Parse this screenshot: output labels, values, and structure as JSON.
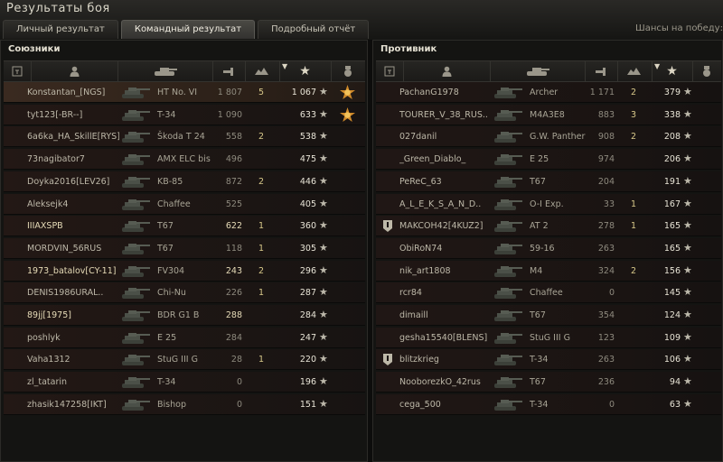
{
  "window": {
    "title": "Результаты боя"
  },
  "tabs": [
    {
      "label": "Личный результат",
      "active": false
    },
    {
      "label": "Командный результат",
      "active": true
    },
    {
      "label": "Подробный отчёт",
      "active": false
    }
  ],
  "win_chance_label": "Шансы на победу: (",
  "columns": {
    "squad_icon": "platoon-icon",
    "player_icon": "player-icon",
    "tank_icon": "tank-icon",
    "damage_icon": "damage-icon",
    "kills_icon": "kills-icon",
    "xp_icon": "star-icon",
    "medal_icon": "medal-icon",
    "sort_indicator": "▼"
  },
  "allies": {
    "title": "Союзники",
    "rows": [
      {
        "name": "Konstantan_[NGS]",
        "tank": "HT No. VI",
        "damage": "1 807",
        "kills": "5",
        "xp": "1 067",
        "achievement": true,
        "highlight": true
      },
      {
        "name": "tyt123[-BR--]",
        "tank": "T-34",
        "damage": "1 090",
        "kills": "",
        "xp": "633",
        "achievement": true
      },
      {
        "name": "6a6ka_HA_SkillE[RYS]",
        "tank": "Škoda T 24",
        "damage": "558",
        "kills": "2",
        "xp": "538"
      },
      {
        "name": "73nagibator7",
        "tank": "AMX ELC bis",
        "damage": "496",
        "kills": "",
        "xp": "475"
      },
      {
        "name": "Doyka2016[LEV26]",
        "tank": "KB-85",
        "damage": "872",
        "kills": "2",
        "xp": "446"
      },
      {
        "name": "Aleksejk4",
        "tank": "Chaffee",
        "damage": "525",
        "kills": "",
        "xp": "405"
      },
      {
        "name": "IIIAXSPB",
        "tank": "T67",
        "damage": "622",
        "kills": "1",
        "xp": "360",
        "platoon": true
      },
      {
        "name": "MORDVIN_56RUS",
        "tank": "T67",
        "damage": "118",
        "kills": "1",
        "xp": "305"
      },
      {
        "name": "1973_batalov[CY-11]",
        "tank": "FV304",
        "damage": "243",
        "kills": "2",
        "xp": "296",
        "platoon": true
      },
      {
        "name": "DENIS1986URAL..",
        "tank": "Chi-Nu",
        "damage": "226",
        "kills": "1",
        "xp": "287"
      },
      {
        "name": "89jj[1975]",
        "tank": "BDR G1 B",
        "damage": "288",
        "kills": "",
        "xp": "284",
        "platoon": true
      },
      {
        "name": "poshlyk",
        "tank": "E 25",
        "damage": "284",
        "kills": "",
        "xp": "247"
      },
      {
        "name": "Vaha1312",
        "tank": "StuG III G",
        "damage": "28",
        "kills": "1",
        "xp": "220"
      },
      {
        "name": "zl_tatarin",
        "tank": "T-34",
        "damage": "0",
        "kills": "",
        "xp": "196"
      },
      {
        "name": "zhasik147258[IKT]",
        "tank": "Bishop",
        "damage": "0",
        "kills": "",
        "xp": "151"
      }
    ]
  },
  "enemies": {
    "title": "Противник",
    "rows": [
      {
        "name": "PachanG1978",
        "tank": "Archer",
        "damage": "1 171",
        "kills": "2",
        "xp": "379"
      },
      {
        "name": "TOURER_V_38_RUS..",
        "tank": "M4A3E8",
        "damage": "883",
        "kills": "3",
        "xp": "338"
      },
      {
        "name": "027danil",
        "tank": "G.W. Panther",
        "damage": "908",
        "kills": "2",
        "xp": "208"
      },
      {
        "name": "_Green_Diablo_",
        "tank": "E 25",
        "damage": "974",
        "kills": "",
        "xp": "206"
      },
      {
        "name": "PeReC_63",
        "tank": "T67",
        "damage": "204",
        "kills": "",
        "xp": "191"
      },
      {
        "name": "A_L_E_K_S_A_N_D..",
        "tank": "O-I Exp.",
        "damage": "33",
        "kills": "1",
        "xp": "167"
      },
      {
        "name": "MAKCOH42[4KUZ2]",
        "tank": "AT 2",
        "damage": "278",
        "kills": "1",
        "xp": "165",
        "badge": true
      },
      {
        "name": "ObiRoN74",
        "tank": "59-16",
        "damage": "263",
        "kills": "",
        "xp": "165"
      },
      {
        "name": "nik_art1808",
        "tank": "M4",
        "damage": "324",
        "kills": "2",
        "xp": "156"
      },
      {
        "name": "rcr84",
        "tank": "Chaffee",
        "damage": "0",
        "kills": "",
        "xp": "145"
      },
      {
        "name": "dimaill",
        "tank": "T67",
        "damage": "354",
        "kills": "",
        "xp": "124"
      },
      {
        "name": "gesha15540[BLENS]",
        "tank": "StuG III G",
        "damage": "123",
        "kills": "",
        "xp": "109"
      },
      {
        "name": "blitzkrieg",
        "tank": "T-34",
        "damage": "263",
        "kills": "",
        "xp": "106",
        "badge": true
      },
      {
        "name": "NooborezkO_42rus",
        "tank": "T67",
        "damage": "236",
        "kills": "",
        "xp": "94"
      },
      {
        "name": "cega_500",
        "tank": "T-34",
        "damage": "0",
        "kills": "",
        "xp": "63"
      }
    ]
  }
}
